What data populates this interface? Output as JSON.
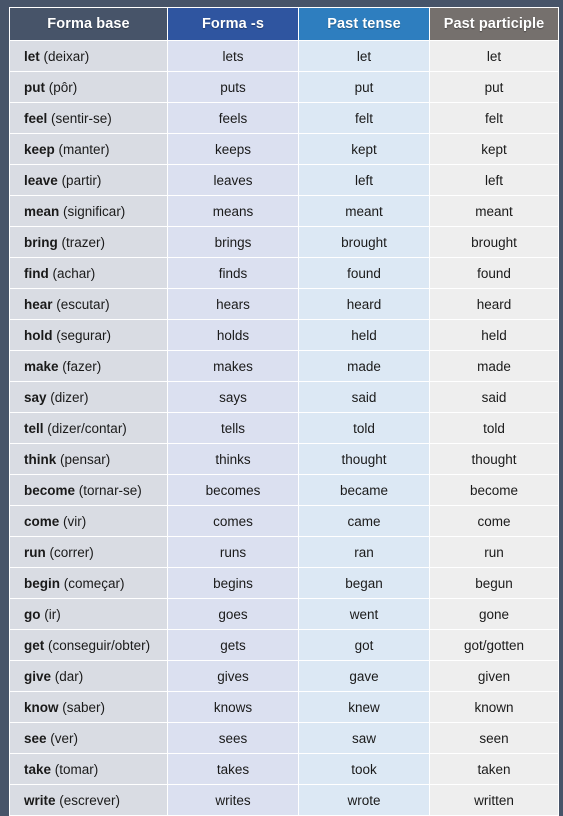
{
  "table": {
    "columns": [
      {
        "key": "base",
        "label": "Forma base",
        "header_bg": "#475469",
        "cell_bg": "#d9dce3"
      },
      {
        "key": "s",
        "label": "Forma -s",
        "header_bg": "#2f55a0",
        "cell_bg": "#dbe0f0"
      },
      {
        "key": "past",
        "label": "Past tense",
        "header_bg": "#2e7ebf",
        "cell_bg": "#dce8f4"
      },
      {
        "key": "pp",
        "label": "Past participle",
        "header_bg": "#75706d",
        "cell_bg": "#eeeeee"
      }
    ],
    "frame_color": "#475469",
    "rows": [
      {
        "verb": "let",
        "gloss": "(deixar)",
        "s": "lets",
        "past": "let",
        "pp": "let"
      },
      {
        "verb": "put",
        "gloss": "(pôr)",
        "s": "puts",
        "past": "put",
        "pp": "put"
      },
      {
        "verb": "feel",
        "gloss": "(sentir-se)",
        "s": "feels",
        "past": "felt",
        "pp": "felt"
      },
      {
        "verb": "keep",
        "gloss": "(manter)",
        "s": "keeps",
        "past": "kept",
        "pp": "kept"
      },
      {
        "verb": "leave",
        "gloss": "(partir)",
        "s": "leaves",
        "past": "left",
        "pp": "left"
      },
      {
        "verb": "mean",
        "gloss": "(significar)",
        "s": "means",
        "past": "meant",
        "pp": "meant"
      },
      {
        "verb": "bring",
        "gloss": "(trazer)",
        "s": "brings",
        "past": "brought",
        "pp": "brought"
      },
      {
        "verb": "find",
        "gloss": "(achar)",
        "s": "finds",
        "past": "found",
        "pp": "found"
      },
      {
        "verb": "hear",
        "gloss": "(escutar)",
        "s": "hears",
        "past": "heard",
        "pp": "heard"
      },
      {
        "verb": "hold",
        "gloss": "(segurar)",
        "s": "holds",
        "past": "held",
        "pp": "held"
      },
      {
        "verb": "make",
        "gloss": "(fazer)",
        "s": "makes",
        "past": "made",
        "pp": "made"
      },
      {
        "verb": "say",
        "gloss": "(dizer)",
        "s": "says",
        "past": "said",
        "pp": "said"
      },
      {
        "verb": "tell",
        "gloss": "(dizer/contar)",
        "s": "tells",
        "past": "told",
        "pp": "told"
      },
      {
        "verb": "think",
        "gloss": "(pensar)",
        "s": "thinks",
        "past": "thought",
        "pp": "thought"
      },
      {
        "verb": "become",
        "gloss": "(tornar-se)",
        "s": "becomes",
        "past": "became",
        "pp": "become"
      },
      {
        "verb": "come",
        "gloss": "(vir)",
        "s": "comes",
        "past": "came",
        "pp": "come"
      },
      {
        "verb": "run",
        "gloss": "(correr)",
        "s": "runs",
        "past": "ran",
        "pp": "run"
      },
      {
        "verb": "begin",
        "gloss": "(começar)",
        "s": "begins",
        "past": "began",
        "pp": "begun"
      },
      {
        "verb": "go",
        "gloss": "(ir)",
        "s": "goes",
        "past": "went",
        "pp": "gone"
      },
      {
        "verb": "get",
        "gloss": "(conseguir/obter)",
        "s": "gets",
        "past": "got",
        "pp": "got/gotten"
      },
      {
        "verb": "give",
        "gloss": "(dar)",
        "s": "gives",
        "past": "gave",
        "pp": "given"
      },
      {
        "verb": "know",
        "gloss": "(saber)",
        "s": "knows",
        "past": "knew",
        "pp": "known"
      },
      {
        "verb": "see",
        "gloss": "(ver)",
        "s": "sees",
        "past": "saw",
        "pp": "seen"
      },
      {
        "verb": "take",
        "gloss": "(tomar)",
        "s": "takes",
        "past": "took",
        "pp": "taken"
      },
      {
        "verb": "write",
        "gloss": "(escrever)",
        "s": "writes",
        "past": "wrote",
        "pp": "written"
      }
    ]
  }
}
